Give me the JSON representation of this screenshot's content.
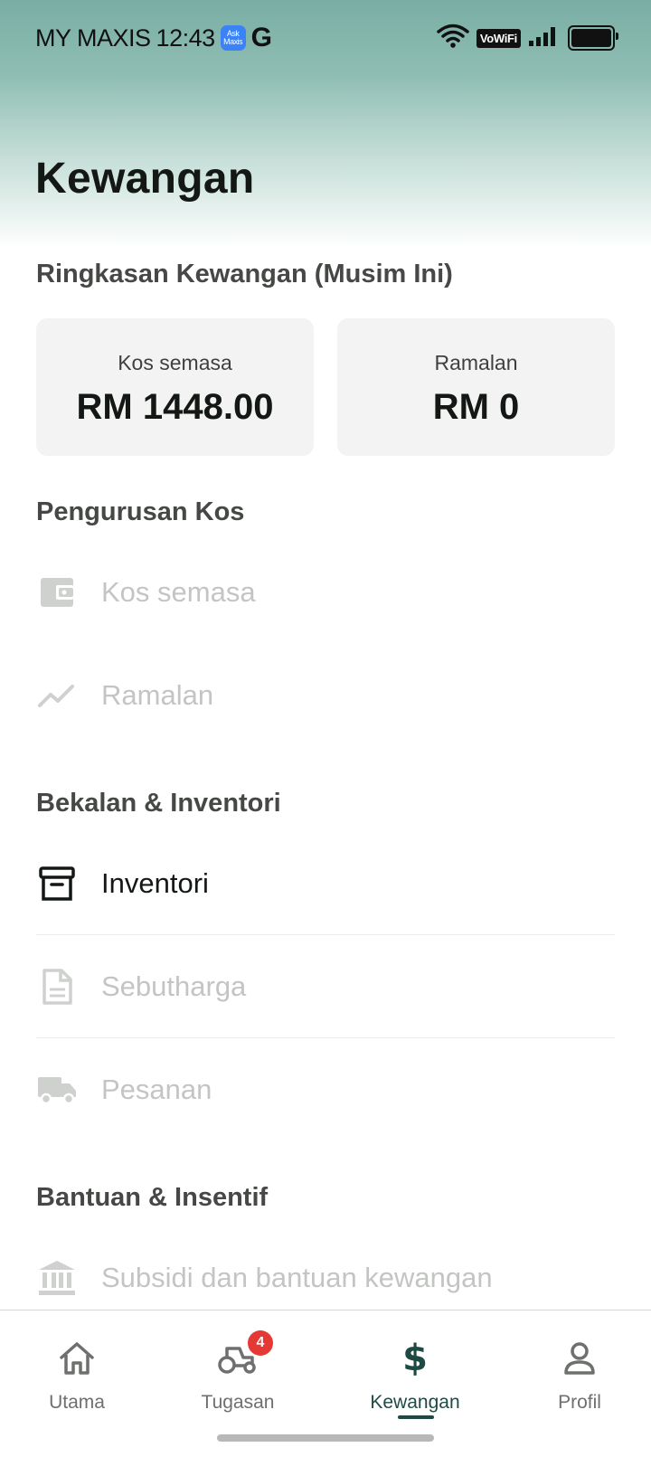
{
  "status_bar": {
    "carrier": "MY MAXIS",
    "time": "12:43",
    "app_icon_text": "Ask Maxis",
    "g_label": "G",
    "vowifi": "VoWiFi"
  },
  "page": {
    "title": "Kewangan"
  },
  "summary": {
    "heading": "Ringkasan Kewangan (Musim Ini)",
    "cards": [
      {
        "label": "Kos semasa",
        "value": "RM 1448.00"
      },
      {
        "label": "Ramalan",
        "value": "RM 0"
      }
    ]
  },
  "cost_management": {
    "heading": "Pengurusan Kos",
    "items": [
      {
        "label": "Kos semasa",
        "icon": "wallet-icon"
      },
      {
        "label": "Ramalan",
        "icon": "trend-icon"
      }
    ]
  },
  "supplies": {
    "heading": "Bekalan & Inventori",
    "items": [
      {
        "label": "Inventori",
        "icon": "archive-box-icon"
      },
      {
        "label": "Sebutharga",
        "icon": "document-icon"
      },
      {
        "label": "Pesanan",
        "icon": "truck-icon"
      }
    ]
  },
  "aid": {
    "heading": "Bantuan & Insentif",
    "items": [
      {
        "label": "Subsidi dan bantuan kewangan",
        "icon": "bank-icon"
      }
    ]
  },
  "bottom_nav": {
    "items": [
      {
        "label": "Utama",
        "icon": "home-icon"
      },
      {
        "label": "Tugasan",
        "icon": "tractor-icon",
        "badge": "4"
      },
      {
        "label": "Kewangan",
        "icon": "dollar-icon"
      },
      {
        "label": "Profil",
        "icon": "person-icon"
      }
    ],
    "active": "Kewangan",
    "active_color": "#1f4a43",
    "badge_color": "#e53935"
  }
}
